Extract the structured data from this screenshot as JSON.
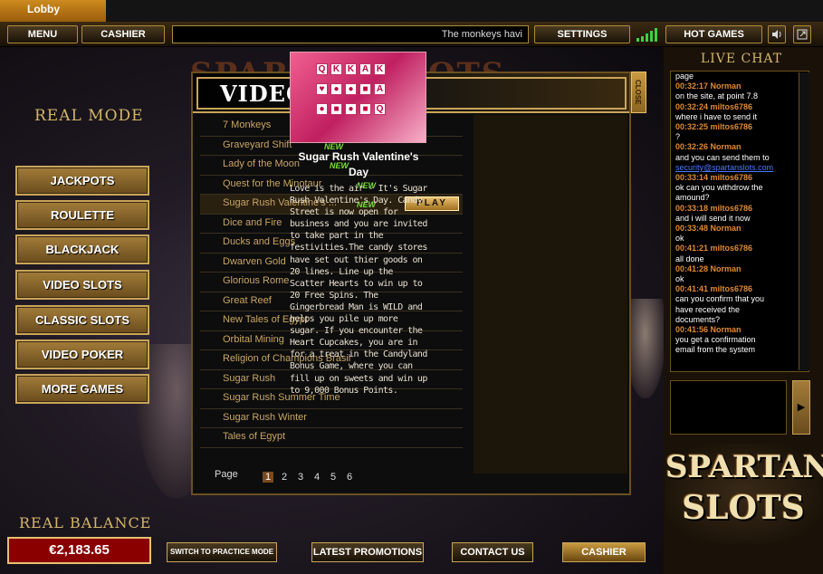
{
  "window": {
    "tab_title": "Lobby"
  },
  "topbar": {
    "menu_label": "MENU",
    "cashier_label": "CASHIER",
    "ticker_text": "The monkeys havi",
    "settings_label": "SETTINGS",
    "hot_games_label": "HOT GAMES"
  },
  "background": {
    "brand_title": "SPARTAN SLOTS"
  },
  "sidebar": {
    "mode_label": "REAL MODE",
    "items": [
      {
        "label": "JACKPOTS"
      },
      {
        "label": "ROULETTE"
      },
      {
        "label": "BLACKJACK"
      },
      {
        "label": "VIDEO SLOTS"
      },
      {
        "label": "CLASSIC SLOTS"
      },
      {
        "label": "VIDEO POKER"
      },
      {
        "label": "MORE GAMES"
      }
    ]
  },
  "balance": {
    "label": "REAL BALANCE",
    "value": "€2,183.65"
  },
  "bottom": {
    "practice_label": "SWITCH TO PRACTICE MODE",
    "promos_label": "LATEST PROMOTIONS",
    "contact_label": "CONTACT US",
    "cashier_label": "CASHIER"
  },
  "modal": {
    "title": "VIDEO SLOTS",
    "close_label": "CLOSE",
    "new_badge": "NEW",
    "play_label": "PLAY",
    "games": [
      {
        "name": "7 Monkeys",
        "is_new": true
      },
      {
        "name": "Graveyard Shift",
        "is_new": true
      },
      {
        "name": "Lady of the Moon",
        "is_new": true
      },
      {
        "name": "Quest for the Minotaur",
        "is_new": true
      },
      {
        "name": "Sugar Rush Valentine's ...",
        "is_new": true,
        "selected": true
      },
      {
        "name": "Dice and Fire",
        "is_new": false
      },
      {
        "name": "Ducks and Eggs",
        "is_new": false
      },
      {
        "name": "Dwarven Gold",
        "is_new": false
      },
      {
        "name": "Glorious Rome",
        "is_new": false
      },
      {
        "name": "Great Reef",
        "is_new": false
      },
      {
        "name": "New Tales of Egypt",
        "is_new": false
      },
      {
        "name": "Orbital Mining",
        "is_new": false
      },
      {
        "name": "Religion of Champions Brasil",
        "is_new": false
      },
      {
        "name": "Sugar Rush",
        "is_new": false
      },
      {
        "name": "Sugar Rush Summer Time",
        "is_new": false
      },
      {
        "name": "Sugar Rush Winter",
        "is_new": false
      },
      {
        "name": "Tales of Egypt",
        "is_new": false
      }
    ],
    "pager": {
      "label": "Page",
      "pages": [
        "1",
        "2",
        "3",
        "4",
        "5",
        "6"
      ],
      "current": "1"
    },
    "detail": {
      "title": "Sugar Rush Valentine's Day",
      "description": "Love is the air - It's Sugar Rush Valentine's Day. Candy Street is now open for business and you are invited to take part in the festivities.The candy stores have set out thier goods on 20 lines. Line up the Scatter Hearts to win up to 20 Free Spins. The Gingerbread Man is WILD and helps you pile up more sugar. If you encounter the Heart Cupcakes, you are in for a treat in the Candyland Bonus Game, where you can fill up on sweets and win up to 9,000 Bonus Points."
    }
  },
  "chat": {
    "title": "LIVE CHAT",
    "lines": [
      {
        "type": "m",
        "text": "page"
      },
      {
        "type": "t",
        "text": "00:32:17 Norman"
      },
      {
        "type": "m",
        "text": "on the site, at point 7.8"
      },
      {
        "type": "t",
        "text": "00:32:24 miltos6786"
      },
      {
        "type": "m",
        "text": "where i have to send it"
      },
      {
        "type": "t",
        "text": "00:32:25 miltos6786"
      },
      {
        "type": "m",
        "text": "?"
      },
      {
        "type": "t",
        "text": "00:32:26 Norman"
      },
      {
        "type": "m",
        "text": "and you can send them to"
      },
      {
        "type": "l",
        "text": "security@spartanslots.com"
      },
      {
        "type": "t",
        "text": "00:33:14 miltos6786"
      },
      {
        "type": "m",
        "text": "ok can you withdrow the"
      },
      {
        "type": "m",
        "text": "amound?"
      },
      {
        "type": "t",
        "text": "00:33:18 miltos6786"
      },
      {
        "type": "m",
        "text": "and i will send it now"
      },
      {
        "type": "t",
        "text": "00:33:48 Norman"
      },
      {
        "type": "m",
        "text": "ok"
      },
      {
        "type": "t",
        "text": "00:41:21 miltos6786"
      },
      {
        "type": "m",
        "text": "all done"
      },
      {
        "type": "t",
        "text": "00:41:28 Norman"
      },
      {
        "type": "m",
        "text": "ok"
      },
      {
        "type": "t",
        "text": "00:41:41 miltos6786"
      },
      {
        "type": "m",
        "text": "can you confirm that you"
      },
      {
        "type": "m",
        "text": "have received the"
      },
      {
        "type": "m",
        "text": "documents?"
      },
      {
        "type": "t",
        "text": "00:41:56 Norman"
      },
      {
        "type": "m",
        "text": "you get a confirmation"
      },
      {
        "type": "m",
        "text": "email from the system"
      }
    ]
  },
  "logo": {
    "line1": "SPARTAN",
    "line2": "SLOTS"
  },
  "colors": {
    "gold": "#c9a55a",
    "new_badge": "#7adf3a",
    "chat_time": "#e08a30",
    "balance_bg": "#8a0000"
  }
}
